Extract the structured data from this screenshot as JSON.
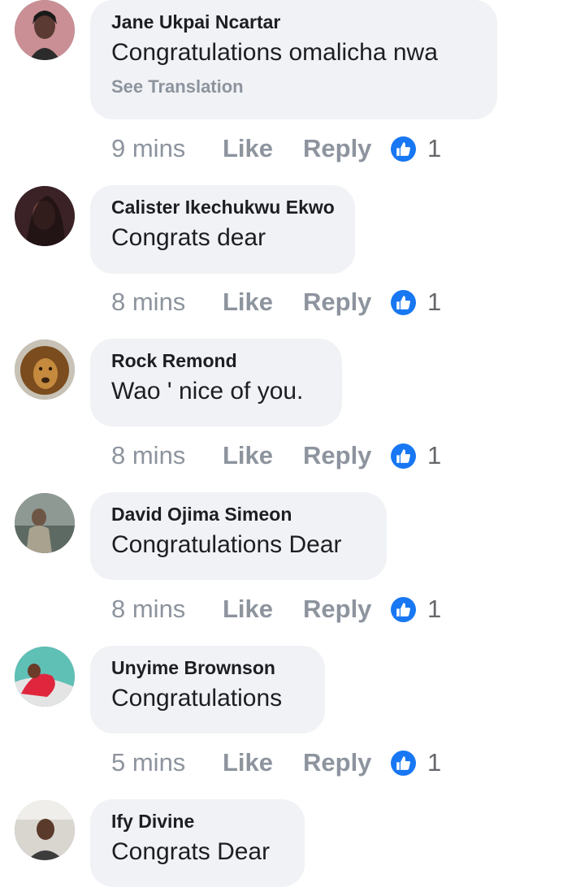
{
  "action_labels": {
    "like": "Like",
    "reply": "Reply"
  },
  "colors": {
    "bubble": "#f0f2f5",
    "author": "#1c1e21",
    "meta": "#8d949e",
    "like_badge": "#1877f2"
  },
  "comments": [
    {
      "author": "Jane Ukpai Ncartar",
      "text": "Congratulations omalicha nwa",
      "see_translation": "See Translation",
      "time": "9 mins",
      "reaction_icon": "thumbs-up-icon",
      "reaction_count": "1"
    },
    {
      "author": "Calister Ikechukwu Ekwo",
      "text": "Congrats dear",
      "time": "8 mins",
      "reaction_icon": "thumbs-up-icon",
      "reaction_count": "1"
    },
    {
      "author": "Rock Remond",
      "text": "Wao ' nice of you.",
      "time": "8 mins",
      "reaction_icon": "thumbs-up-icon",
      "reaction_count": "1"
    },
    {
      "author": "David Ojima Simeon",
      "text": "Congratulations Dear",
      "time": "8 mins",
      "reaction_icon": "thumbs-up-icon",
      "reaction_count": "1"
    },
    {
      "author": "Unyime Brownson",
      "text": "Congratulations",
      "time": "5 mins",
      "reaction_icon": "thumbs-up-icon",
      "reaction_count": "1"
    },
    {
      "author": "Ify Divine",
      "text": "Congrats Dear"
    }
  ]
}
